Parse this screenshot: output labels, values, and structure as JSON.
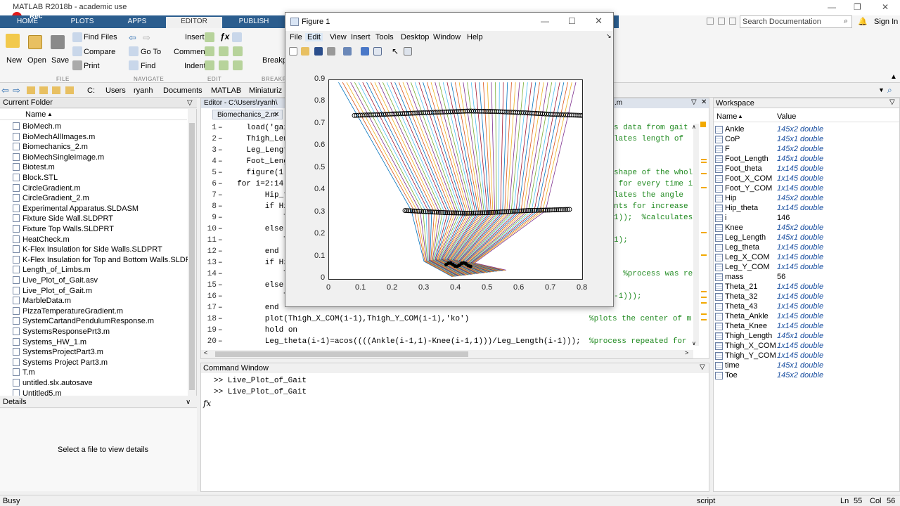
{
  "app": {
    "title": "MATLAB R2018b - academic use",
    "rec_label": "Rec"
  },
  "tabs": [
    {
      "label": "HOME"
    },
    {
      "label": "PLOTS"
    },
    {
      "label": "APPS"
    },
    {
      "label": "EDITOR"
    },
    {
      "label": "PUBLISH"
    }
  ],
  "search": {
    "placeholder": "Search Documentation"
  },
  "signin": "Sign In",
  "ribbon": {
    "file": {
      "new": "New",
      "open": "Open",
      "save": "Save",
      "find_files": "Find Files",
      "compare": "Compare",
      "print": "Print",
      "group": "FILE"
    },
    "navigate": {
      "goto": "Go To",
      "find": "Find",
      "group": "NAVIGATE"
    },
    "edit": {
      "insert": "Insert",
      "comment": "Comment",
      "indent": "Indent",
      "group": "EDIT"
    },
    "breakpoints": {
      "label": "Breakpo",
      "group": "BREAKPO"
    }
  },
  "breadcrumb": [
    "C:",
    "Users",
    "ryanh",
    "Documents",
    "MATLAB",
    "Miniaturiz"
  ],
  "current_folder": {
    "title": "Current Folder",
    "col_name": "Name",
    "files": [
      "BioMech.m",
      "BioMechAllImages.m",
      "Biomechanics_2.m",
      "BioMechSingleImage.m",
      "Biotest.m",
      "Block.STL",
      "CircleGradient.m",
      "CircleGradient_2.m",
      "Experimental Apparatus.SLDASM",
      "Fixture Side Wall.SLDPRT",
      "Fixture Top Walls.SLDPRT",
      "HeatCheck.m",
      "K-Flex Insulation for Side Walls.SLDPRT",
      "K-Flex Insulation for Top and Bottom Walls.SLDPRT",
      "Length_of_Limbs.m",
      "Live_Plot_of_Gait.asv",
      "Live_Plot_of_Gait.m",
      "MarbleData.m",
      "PizzaTemperatureGradient.m",
      "SystemCartandPendulumResponse.m",
      "SystemsResponsePrt3.m",
      "Systems_HW_1.m",
      "SystemsProjectPart3.m",
      "Systems Project  Part3.m",
      "T.m",
      "untitled.slx.autosave",
      "Untitled5.m"
    ]
  },
  "details": {
    "title": "Details",
    "empty_text": "Select a file to view details"
  },
  "editor": {
    "title": "Editor - C:\\Users\\ryanh\\",
    "title_tail": ".m",
    "tab": "Biomechanics_2.m",
    "lines": [
      {
        "n": "1",
        "code": "    load('gait",
        "comment": "s data from gait"
      },
      {
        "n": "2",
        "code": "    Thigh_Leng",
        "comment": "lates length of"
      },
      {
        "n": "3",
        "code": "    Leg_Length",
        "comment": ""
      },
      {
        "n": "4",
        "code": "    Foot_Lengt",
        "comment": ""
      },
      {
        "n": "5",
        "code": "    figure(1);",
        "comment": "shape of the whol"
      },
      {
        "n": "6",
        "code": "  for i=2:14",
        "comment": " for every time i"
      },
      {
        "n": "7",
        "code": "        Hip_the",
        "comment": "lates the angle"
      },
      {
        "n": "8",
        "code": "        if Hip",
        "comment": "nts for increase"
      },
      {
        "n": "9",
        "code": "            Thi",
        "comment": "1));  %calculates"
      },
      {
        "n": "10",
        "code": "        else",
        "comment": ""
      },
      {
        "n": "11",
        "code": "            Thi",
        "comment": "1);"
      },
      {
        "n": "12",
        "code": "        end",
        "comment": ""
      },
      {
        "n": "13",
        "code": "        if Hip",
        "comment": ""
      },
      {
        "n": "14",
        "code": "            Thi",
        "comment": "  %process was re"
      },
      {
        "n": "15",
        "code": "        else",
        "comment": ""
      },
      {
        "n": "16",
        "code": "            Thi",
        "comment": "-1)));"
      },
      {
        "n": "17",
        "code": "        end",
        "comment": ""
      },
      {
        "n": "18",
        "code": "        plot(Thigh_X_COM(i-1),Thigh_Y_COM(i-1),'ko')",
        "comment": "%plots the center of m"
      },
      {
        "n": "19",
        "code": "        hold on",
        "comment": ""
      },
      {
        "n": "20",
        "code": "        Leg_theta(i-1)=acos((((Ankle(i-1,1)-Knee(i-1,1)))/Leg_Length(i-1)));",
        "comment": "%process repeated for"
      }
    ]
  },
  "command_window": {
    "title": "Command Window",
    "lines": [
      ">> Live_Plot_of_Gait",
      ">> Live_Plot_of_Gait"
    ],
    "prompt": "fx"
  },
  "workspace": {
    "title": "Workspace",
    "col_name": "Name",
    "col_value": "Value",
    "vars": [
      {
        "name": "Ankle",
        "value": "145x2 double",
        "numeric": false
      },
      {
        "name": "CoP",
        "value": "145x1 double",
        "numeric": false
      },
      {
        "name": "F",
        "value": "145x2 double",
        "numeric": false
      },
      {
        "name": "Foot_Length",
        "value": "145x1 double",
        "numeric": false
      },
      {
        "name": "Foot_theta",
        "value": "1x145 double",
        "numeric": false
      },
      {
        "name": "Foot_X_COM",
        "value": "1x145 double",
        "numeric": false
      },
      {
        "name": "Foot_Y_COM",
        "value": "1x145 double",
        "numeric": false
      },
      {
        "name": "Hip",
        "value": "145x2 double",
        "numeric": false
      },
      {
        "name": "Hip_theta",
        "value": "1x145 double",
        "numeric": false
      },
      {
        "name": "i",
        "value": "146",
        "numeric": true
      },
      {
        "name": "Knee",
        "value": "145x2 double",
        "numeric": false
      },
      {
        "name": "Leg_Length",
        "value": "145x1 double",
        "numeric": false
      },
      {
        "name": "Leg_theta",
        "value": "1x145 double",
        "numeric": false
      },
      {
        "name": "Leg_X_COM",
        "value": "1x145 double",
        "numeric": false
      },
      {
        "name": "Leg_Y_COM",
        "value": "1x145 double",
        "numeric": false
      },
      {
        "name": "mass",
        "value": "56",
        "numeric": true
      },
      {
        "name": "Theta_21",
        "value": "1x145 double",
        "numeric": false
      },
      {
        "name": "Theta_32",
        "value": "1x145 double",
        "numeric": false
      },
      {
        "name": "Theta_43",
        "value": "1x145 double",
        "numeric": false
      },
      {
        "name": "Theta_Ankle",
        "value": "1x145 double",
        "numeric": false
      },
      {
        "name": "Theta_Knee",
        "value": "1x145 double",
        "numeric": false
      },
      {
        "name": "Thigh_Length",
        "value": "145x1 double",
        "numeric": false
      },
      {
        "name": "Thigh_X_COM",
        "value": "1x145 double",
        "numeric": false
      },
      {
        "name": "Thigh_Y_COM",
        "value": "1x145 double",
        "numeric": false
      },
      {
        "name": "time",
        "value": "145x1 double",
        "numeric": false
      },
      {
        "name": "Toe",
        "value": "145x2 double",
        "numeric": false
      }
    ]
  },
  "status": {
    "busy": "Busy",
    "mode": "script",
    "ln_label": "Ln",
    "ln": "55",
    "col_label": "Col",
    "col": "56"
  },
  "figure": {
    "title": "Figure 1",
    "menu": [
      "File",
      "Edit",
      "View",
      "Insert",
      "Tools",
      "Desktop",
      "Window",
      "Help"
    ],
    "xticks": [
      "0",
      "0.1",
      "0.2",
      "0.3",
      "0.4",
      "0.5",
      "0.6",
      "0.7",
      "0.8"
    ],
    "yticks": [
      "0",
      "0.1",
      "0.2",
      "0.3",
      "0.4",
      "0.5",
      "0.6",
      "0.7",
      "0.8",
      "0.9"
    ]
  },
  "colors": {
    "tabbar": "#2b5d8e",
    "series": [
      "#0072bd",
      "#d95319",
      "#edb120",
      "#7e2f8e",
      "#77ac30",
      "#4dbeee",
      "#a2142f"
    ]
  },
  "chart_data": {
    "type": "line",
    "xlim": [
      0,
      0.8
    ],
    "ylim": [
      0,
      0.9
    ],
    "grid": false,
    "hip_markers": {
      "x_range": [
        0.08,
        0.8
      ],
      "y": [
        0.74,
        0.745,
        0.75,
        0.755,
        0.76,
        0.758,
        0.752,
        0.745,
        0.74
      ]
    },
    "knee_markers": {
      "x_range": [
        0.24,
        0.76
      ],
      "y": [
        0.31,
        0.305,
        0.3,
        0.298,
        0.3,
        0.305,
        0.31,
        0.312,
        0.315
      ]
    },
    "segments_note": "thigh/leg/foot stick lines per frame"
  }
}
